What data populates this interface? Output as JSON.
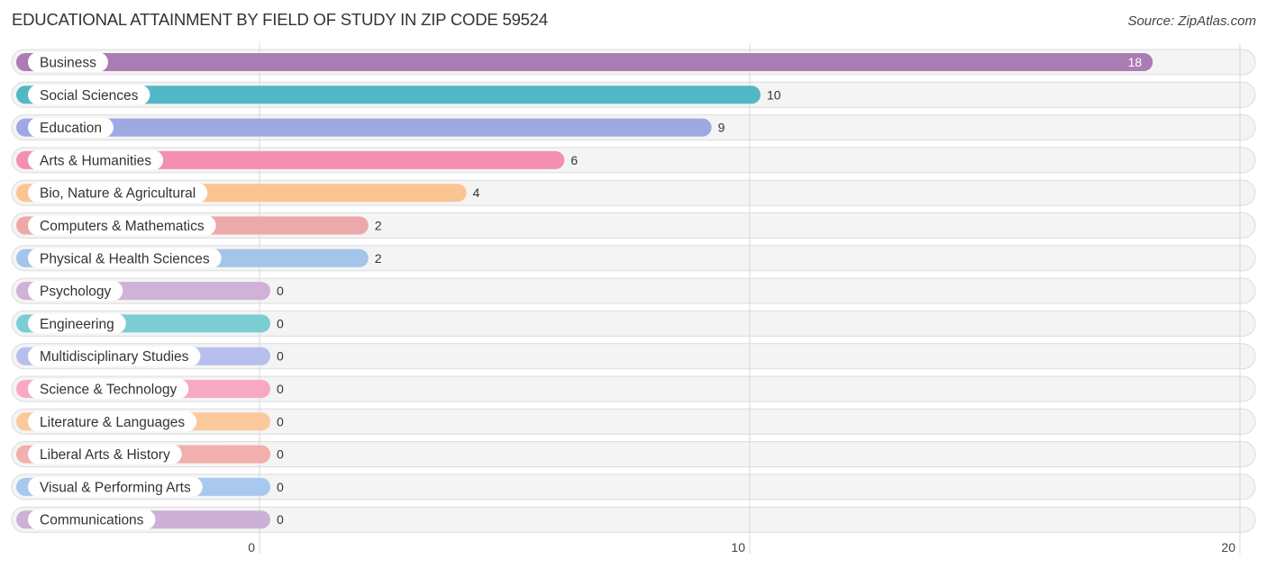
{
  "chart_data": {
    "type": "bar",
    "orientation": "horizontal",
    "title": "EDUCATIONAL ATTAINMENT BY FIELD OF STUDY IN ZIP CODE 59524",
    "source": "Source: ZipAtlas.com",
    "xlabel": "",
    "ylabel": "",
    "xlim": [
      0,
      20
    ],
    "xticks": [
      "0",
      "10",
      "20"
    ],
    "grid": true,
    "categories": [
      "Business",
      "Social Sciences",
      "Education",
      "Arts & Humanities",
      "Bio, Nature & Agricultural",
      "Computers & Mathematics",
      "Physical & Health Sciences",
      "Psychology",
      "Engineering",
      "Multidisciplinary Studies",
      "Science & Technology",
      "Literature & Languages",
      "Liberal Arts & History",
      "Visual & Performing Arts",
      "Communications"
    ],
    "values": [
      18,
      10,
      9,
      6,
      4,
      2,
      2,
      0,
      0,
      0,
      0,
      0,
      0,
      0,
      0
    ],
    "value_labels": [
      "18",
      "10",
      "9",
      "6",
      "4",
      "2",
      "2",
      "0",
      "0",
      "0",
      "0",
      "0",
      "0",
      "0",
      "0"
    ],
    "colors": [
      "#ab7cb3",
      "#52b8c5",
      "#9ea8e3",
      "#f48fb0",
      "#fbc592",
      "#eda9a9",
      "#a4c4ea",
      "#cfb2d6",
      "#7ccdd3",
      "#b6bfee",
      "#f7a9c3",
      "#fbc99c",
      "#f1afae",
      "#a8c8ef",
      "#cdb0d5"
    ]
  }
}
